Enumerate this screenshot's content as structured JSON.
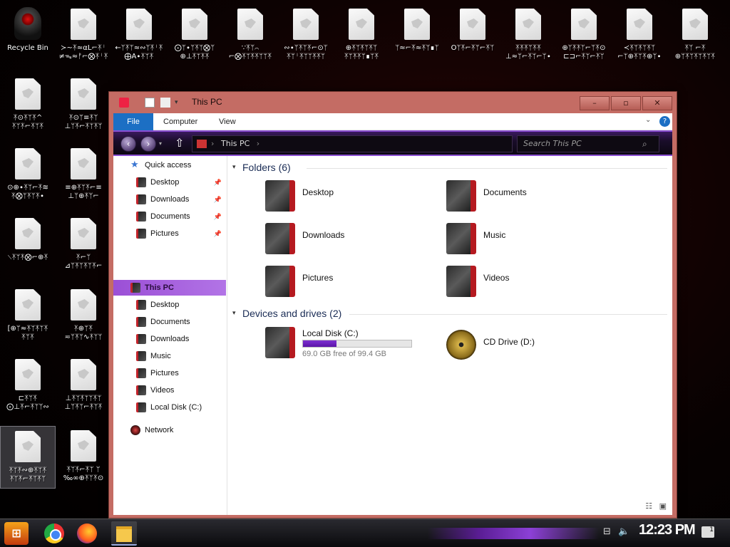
{
  "desktop": {
    "icons": [
      {
        "label": "Recycle Bin",
        "type": "recycle-bin"
      },
      {
        "label": "≻~ᛡ≈αL⌐ᛡᛌ\n≠ᯓ≈ᚠ⌐⨂ᛡᛌᛡ",
        "type": "document"
      },
      {
        "label": "←ᛘᛡᛘ≈∾ᛘᛡᛌᛡ\n⨁A∙ᛡᛘᛡ",
        "type": "document"
      },
      {
        "label": "⨀ᛘ∙ᛘᛡᛘ⨂ᛘ\n⊕⊥ᛡᛘᛡᛡ",
        "type": "document"
      },
      {
        "label": "∵ᛡᛘ⌒\n⌐⨂ᛡᛘᛡᛡᛘᛘᛡ",
        "type": "document"
      },
      {
        "label": "∾∙ᛘᛡᛘᛡ⌐⊙ᛘ\nᛡᛘᛌᛡᛘᛘᛡᛡᛘ",
        "type": "document"
      },
      {
        "label": "⊕ᛡᛘᛡᛘᛡᛘ\nᛡᛘᛡᛡᛘ∎ᛘᛡ",
        "type": "document"
      },
      {
        "label": "ᛘ≈⌐ᛡ≈ᛡᛘ∎ᛘ",
        "type": "document"
      },
      {
        "label": "Öᛘᛡ⌐ᛡᛘ⌐ᛡᛘ",
        "type": "document"
      },
      {
        "label": "ᛡᛡᛡᛘᛡᛡ\n⊥≈ᛘ⌐ᛡᛘ⌐ᛘ∙",
        "type": "document"
      },
      {
        "label": "⊕ᛘᛡᛡᛘ⌐ᛘᛡ⊙\n⊏⊐⌐ᛡᛘ⌐ᛡᛘ",
        "type": "document"
      },
      {
        "label": "≺ᛡᛘᛡᛘᛡᛘ\n⌐ᛘ⊕ᛡᛘᛡ⊕ᛘ∙",
        "type": "document"
      },
      {
        "label": "ᛡᛘ ⌐ᛡ\n⊕ᛘᛡᛘᛡᛘᛡᛘᛡ",
        "type": "document"
      },
      {
        "label": "ᛡ⊙ᛡᛘᛡ^\nᛡᛘᛡ⌐ᛡᛘᛡ",
        "type": "document"
      },
      {
        "label": "ᛡ⊙ᛘ≡ᛡᛘ\n⊥ᛘᛡ⌐ᛡᛘᛡᛘ",
        "type": "document"
      },
      {
        "label": "⊙⊕∙ᛡᛘ⌐ᛡ≋\nᛡ⨂ᛘᛡᛘᛡ∙",
        "type": "document"
      },
      {
        "label": "≡⊕ᛡᛘᛡ⌐≡\n⊥ᛘ⊕ᛡᛘ⌐",
        "type": "document"
      },
      {
        "label": "⟍ᛡᛘᛡ⨂⌐⊕ᛡ",
        "type": "document"
      },
      {
        "label": "ᛡ⌐ᛘ\n⊿ᛘᛡᛘᛡᛘᛡ⌐",
        "type": "document"
      },
      {
        "label": "[⊕ᛘ≈ᛡᛘᛡᛘᛡ\nᛡᛘᛡ",
        "type": "document"
      },
      {
        "label": "ᛡ⊕ᛘᛡ\n≂ᛘᛡᛘ∿ᛡᛘᛘ",
        "type": "document"
      },
      {
        "label": "⊏ᛡᛘᛡ\n⨀⊥ᛡ⌐ᛡᛘᛘ∾",
        "type": "document"
      },
      {
        "label": "⊥ᛡᛘᛡᛘᛘᛡᛘ\n⊥ᛘᛡᛘ⌐ᛡᛘᛡ",
        "type": "document"
      },
      {
        "label": "ᛡᛘᛡ∾⊕ᛡᛘᛡ\nᛡᛘᛡ⌐ᛡᛘᛡᛘ",
        "type": "document"
      },
      {
        "label": "ᛡᛘᛡ⌐ᛡᛘ ᛘ\n‰∞⊕ᛡᛘᛡ⊙",
        "type": "document"
      }
    ]
  },
  "window": {
    "title": "This PC",
    "tabs": [
      "File",
      "Computer",
      "View"
    ],
    "address": {
      "crumb": "This PC"
    },
    "search": {
      "placeholder": "Search This PC"
    },
    "nav": {
      "quick_access": "Quick access",
      "quick_items": [
        "Desktop",
        "Downloads",
        "Documents",
        "Pictures"
      ],
      "this_pc": "This PC",
      "pc_items": [
        "Desktop",
        "Documents",
        "Downloads",
        "Music",
        "Pictures",
        "Videos",
        "Local Disk (C:)"
      ],
      "network": "Network"
    },
    "folders_header": "Folders (6)",
    "folders": [
      "Desktop",
      "Documents",
      "Downloads",
      "Music",
      "Pictures",
      "Videos"
    ],
    "devices_header": "Devices and drives (2)",
    "drives": [
      {
        "name": "Local Disk (C:)",
        "free": "69.0 GB free of 99.4 GB",
        "used_fraction": 0.306
      },
      {
        "name": "CD Drive (D:)"
      }
    ]
  },
  "taskbar": {
    "clock": "12:23 PM",
    "notification_count": "1"
  }
}
